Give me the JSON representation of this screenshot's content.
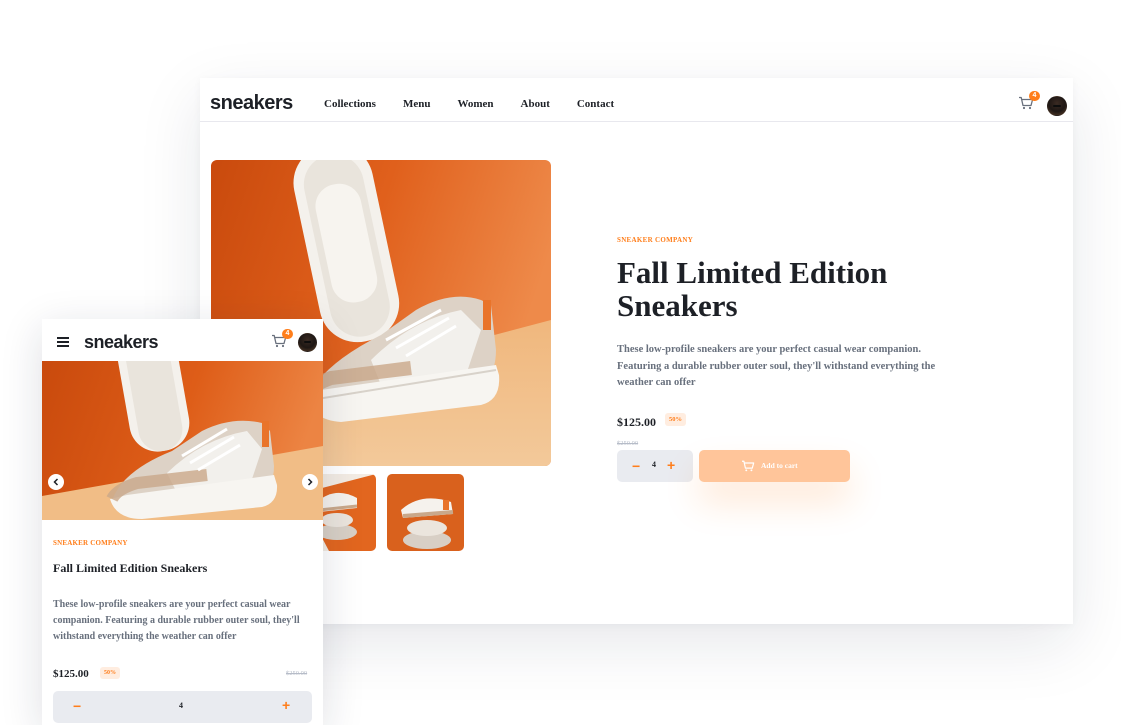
{
  "brand": {
    "name": "sneakers",
    "accent": "#ff7e1b",
    "accent_light": "#ffede0",
    "dark": "#1d2026",
    "muted": "#68707d"
  },
  "nav": {
    "links": [
      "Collections",
      "Menu",
      "Women",
      "About",
      "Contact"
    ]
  },
  "cart": {
    "count": "4",
    "icon": "cart-icon"
  },
  "user": {
    "avatar": "avatar"
  },
  "product": {
    "company": "SNEAKER COMPANY",
    "title": "Fall Limited Edition Sneakers",
    "description": "These low-profile sneakers are your perfect casual wear companion. Featuring a durable rubber outer soul, they'll withstand everything the weather can offer",
    "price": "$125.00",
    "discount": "50%",
    "original_price": "$250.00",
    "quantity": "4",
    "minus": "−",
    "plus": "+",
    "add_to_cart": "Add to cart"
  },
  "gallery": {
    "thumbnails": [
      "thumbnail-2",
      "thumbnail-3",
      "thumbnail-4"
    ]
  },
  "mobile": {
    "menu_icon": "hamburger-icon",
    "prev_icon": "chevron-left-icon",
    "next_icon": "chevron-right-icon"
  }
}
